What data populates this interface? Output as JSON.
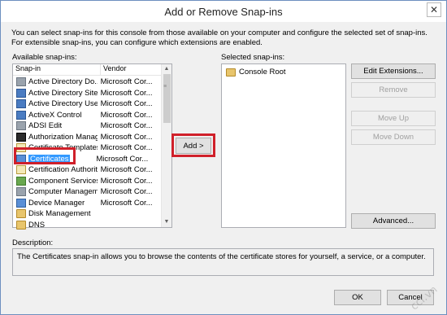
{
  "window": {
    "title": "Add or Remove Snap-ins",
    "close_label": "✕"
  },
  "info": "You can select snap-ins for this console from those available on your computer and configure the selected set of snap-ins. For extensible snap-ins, you can configure which extensions are enabled.",
  "available": {
    "label": "Available snap-ins:",
    "columns": [
      "Snap-in",
      "Vendor"
    ],
    "rows": [
      {
        "name": "Active Directory Do...",
        "vendor": "Microsoft Cor...",
        "icon": "gray"
      },
      {
        "name": "Active Directory Site...",
        "vendor": "Microsoft Cor...",
        "icon": "blue"
      },
      {
        "name": "Active Directory Use...",
        "vendor": "Microsoft Cor...",
        "icon": "blue"
      },
      {
        "name": "ActiveX Control",
        "vendor": "Microsoft Cor...",
        "icon": "blue"
      },
      {
        "name": "ADSI Edit",
        "vendor": "Microsoft Cor...",
        "icon": "gray"
      },
      {
        "name": "Authorization Manager",
        "vendor": "Microsoft Cor...",
        "icon": "dark"
      },
      {
        "name": "Certificate Templates",
        "vendor": "Microsoft Cor...",
        "icon": "cert"
      },
      {
        "name": "Certificates",
        "vendor": "Microsoft Cor...",
        "icon": "screen",
        "selected": true
      },
      {
        "name": "Certification Authority",
        "vendor": "Microsoft Cor...",
        "icon": "cert"
      },
      {
        "name": "Component Services",
        "vendor": "Microsoft Cor...",
        "icon": "green"
      },
      {
        "name": "Computer Managem...",
        "vendor": "Microsoft Cor...",
        "icon": "gray"
      },
      {
        "name": "Device Manager",
        "vendor": "Microsoft Cor...",
        "icon": "screen"
      },
      {
        "name": "Disk Management",
        "vendor": "",
        "icon": "folder"
      },
      {
        "name": "DNS",
        "vendor": "",
        "icon": "folder"
      }
    ]
  },
  "add_button": "Add >",
  "selected": {
    "label": "Selected snap-ins:",
    "root": "Console Root"
  },
  "right_buttons": {
    "edit_extensions": "Edit Extensions...",
    "remove": "Remove",
    "move_up": "Move Up",
    "move_down": "Move Down",
    "advanced": "Advanced..."
  },
  "description": {
    "label": "Description:",
    "text": "The Certificates snap-in allows you to browse the contents of the certificate stores for yourself, a service, or a computer."
  },
  "footer": {
    "ok": "OK",
    "cancel": "Cancel"
  },
  "watermark": "ccl.vn",
  "highlight_color": "#d0202a",
  "selection_color": "#3399ff"
}
